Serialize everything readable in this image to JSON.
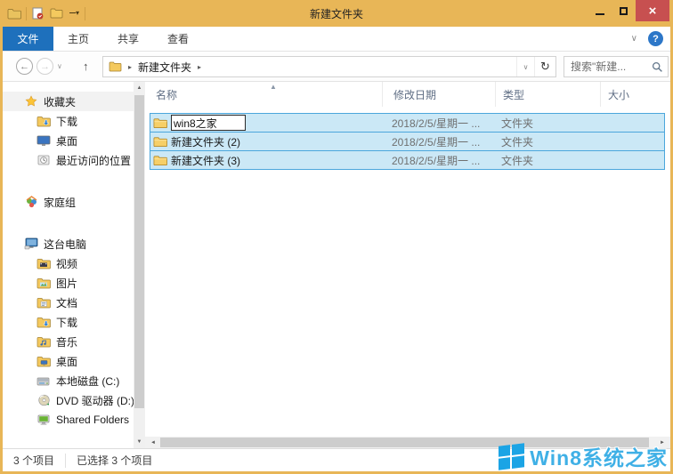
{
  "colors": {
    "titlebar_gold": "#e8b657",
    "file_tab_blue": "#1e70bc",
    "close_red": "#c75050",
    "selection_fill": "#cbe8f6",
    "selection_border": "#4ba6dc",
    "watermark_blue": "#3fb0e6"
  },
  "titlebar": {
    "title": "新建文件夹"
  },
  "ribbon": {
    "file_tab": "文件",
    "tabs": [
      "主页",
      "共享",
      "查看"
    ]
  },
  "navbar": {
    "breadcrumb_root": "新建文件夹",
    "search_placeholder": "搜索\"新建...",
    "search_value": ""
  },
  "icons": {
    "back": "←",
    "forward": "→",
    "nav_dropdown": "∨",
    "up_arrow": "↑",
    "breadcrumb_sep": "▸",
    "address_dropdown": "∨",
    "refresh": "↻",
    "ribbon_collapse": "∨",
    "help": "?",
    "close": "×",
    "sort_asc": "▲",
    "scroll_up": "▲",
    "scroll_down": "▼",
    "scroll_left": "◄",
    "scroll_right": "►",
    "qat_dropdown": "▾"
  },
  "columns": {
    "name": "名称",
    "date": "修改日期",
    "type": "类型",
    "size": "大小"
  },
  "sidebar": {
    "favorites": {
      "label": "收藏夹",
      "items": [
        "下载",
        "桌面",
        "最近访问的位置"
      ]
    },
    "homegroup": {
      "label": "家庭组"
    },
    "this_pc": {
      "label": "这台电脑",
      "items": [
        "视频",
        "图片",
        "文档",
        "下载",
        "音乐",
        "桌面",
        "本地磁盘 (C:)",
        "DVD 驱动器 (D:)",
        "Shared Folders"
      ]
    }
  },
  "files": {
    "rename_value": "win8之家",
    "rows": [
      {
        "name": "win8之家",
        "date": "2018/2/5/星期一 ...",
        "type": "文件夹",
        "size": ""
      },
      {
        "name": "新建文件夹 (2)",
        "date": "2018/2/5/星期一 ...",
        "type": "文件夹",
        "size": ""
      },
      {
        "name": "新建文件夹 (3)",
        "date": "2018/2/5/星期一 ...",
        "type": "文件夹",
        "size": ""
      }
    ]
  },
  "statusbar": {
    "items_count": "3 个项目",
    "selected_count": "已选择 3 个项目"
  },
  "watermark": {
    "text": "Win8系统之家"
  }
}
